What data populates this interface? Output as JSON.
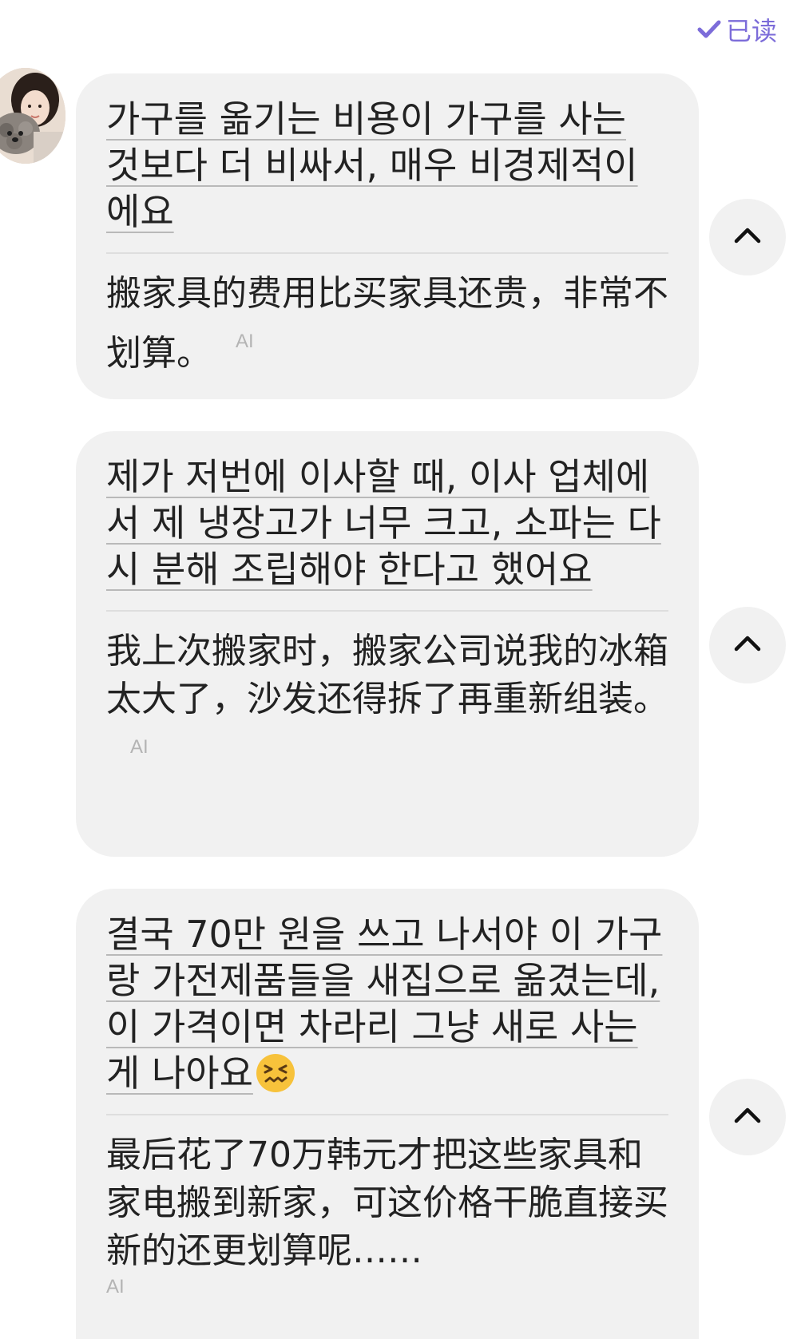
{
  "header": {
    "read_status": "已读",
    "check_icon": "check-icon"
  },
  "accent_color": "#7c6cd9",
  "messages": [
    {
      "korean": "가구를 옮기는 비용이 가구를 사는 것보다 더 비싸서, 매우 비경제적이에요",
      "chinese": "搬家具的费用比买家具还贵，非常不划算。",
      "ai_label": "AI"
    },
    {
      "korean": "제가 저번에 이사할 때, 이사 업체에서 제 냉장고가 너무 크고, 소파는 다시 분해 조립해야 한다고 했어요",
      "chinese": "我上次搬家时，搬家公司说我的冰箱太大了，沙发还得拆了再重新组装。",
      "ai_label": "AI"
    },
    {
      "korean": "결국 70만 원을 쓰고 나서야 이 가구랑 가전제품들을 새집으로 옮겼는데, 이 가격이면 차라리 그냥 새로 사는 게 나아요",
      "emoji": "confounded-face-emoji",
      "chinese": "最后花了70万韩元才把这些家具和家电搬到新家，可这价格干脆直接买新的还更划算呢……",
      "ai_label": "AI"
    }
  ],
  "collapse_icon": "chevron-up-icon"
}
